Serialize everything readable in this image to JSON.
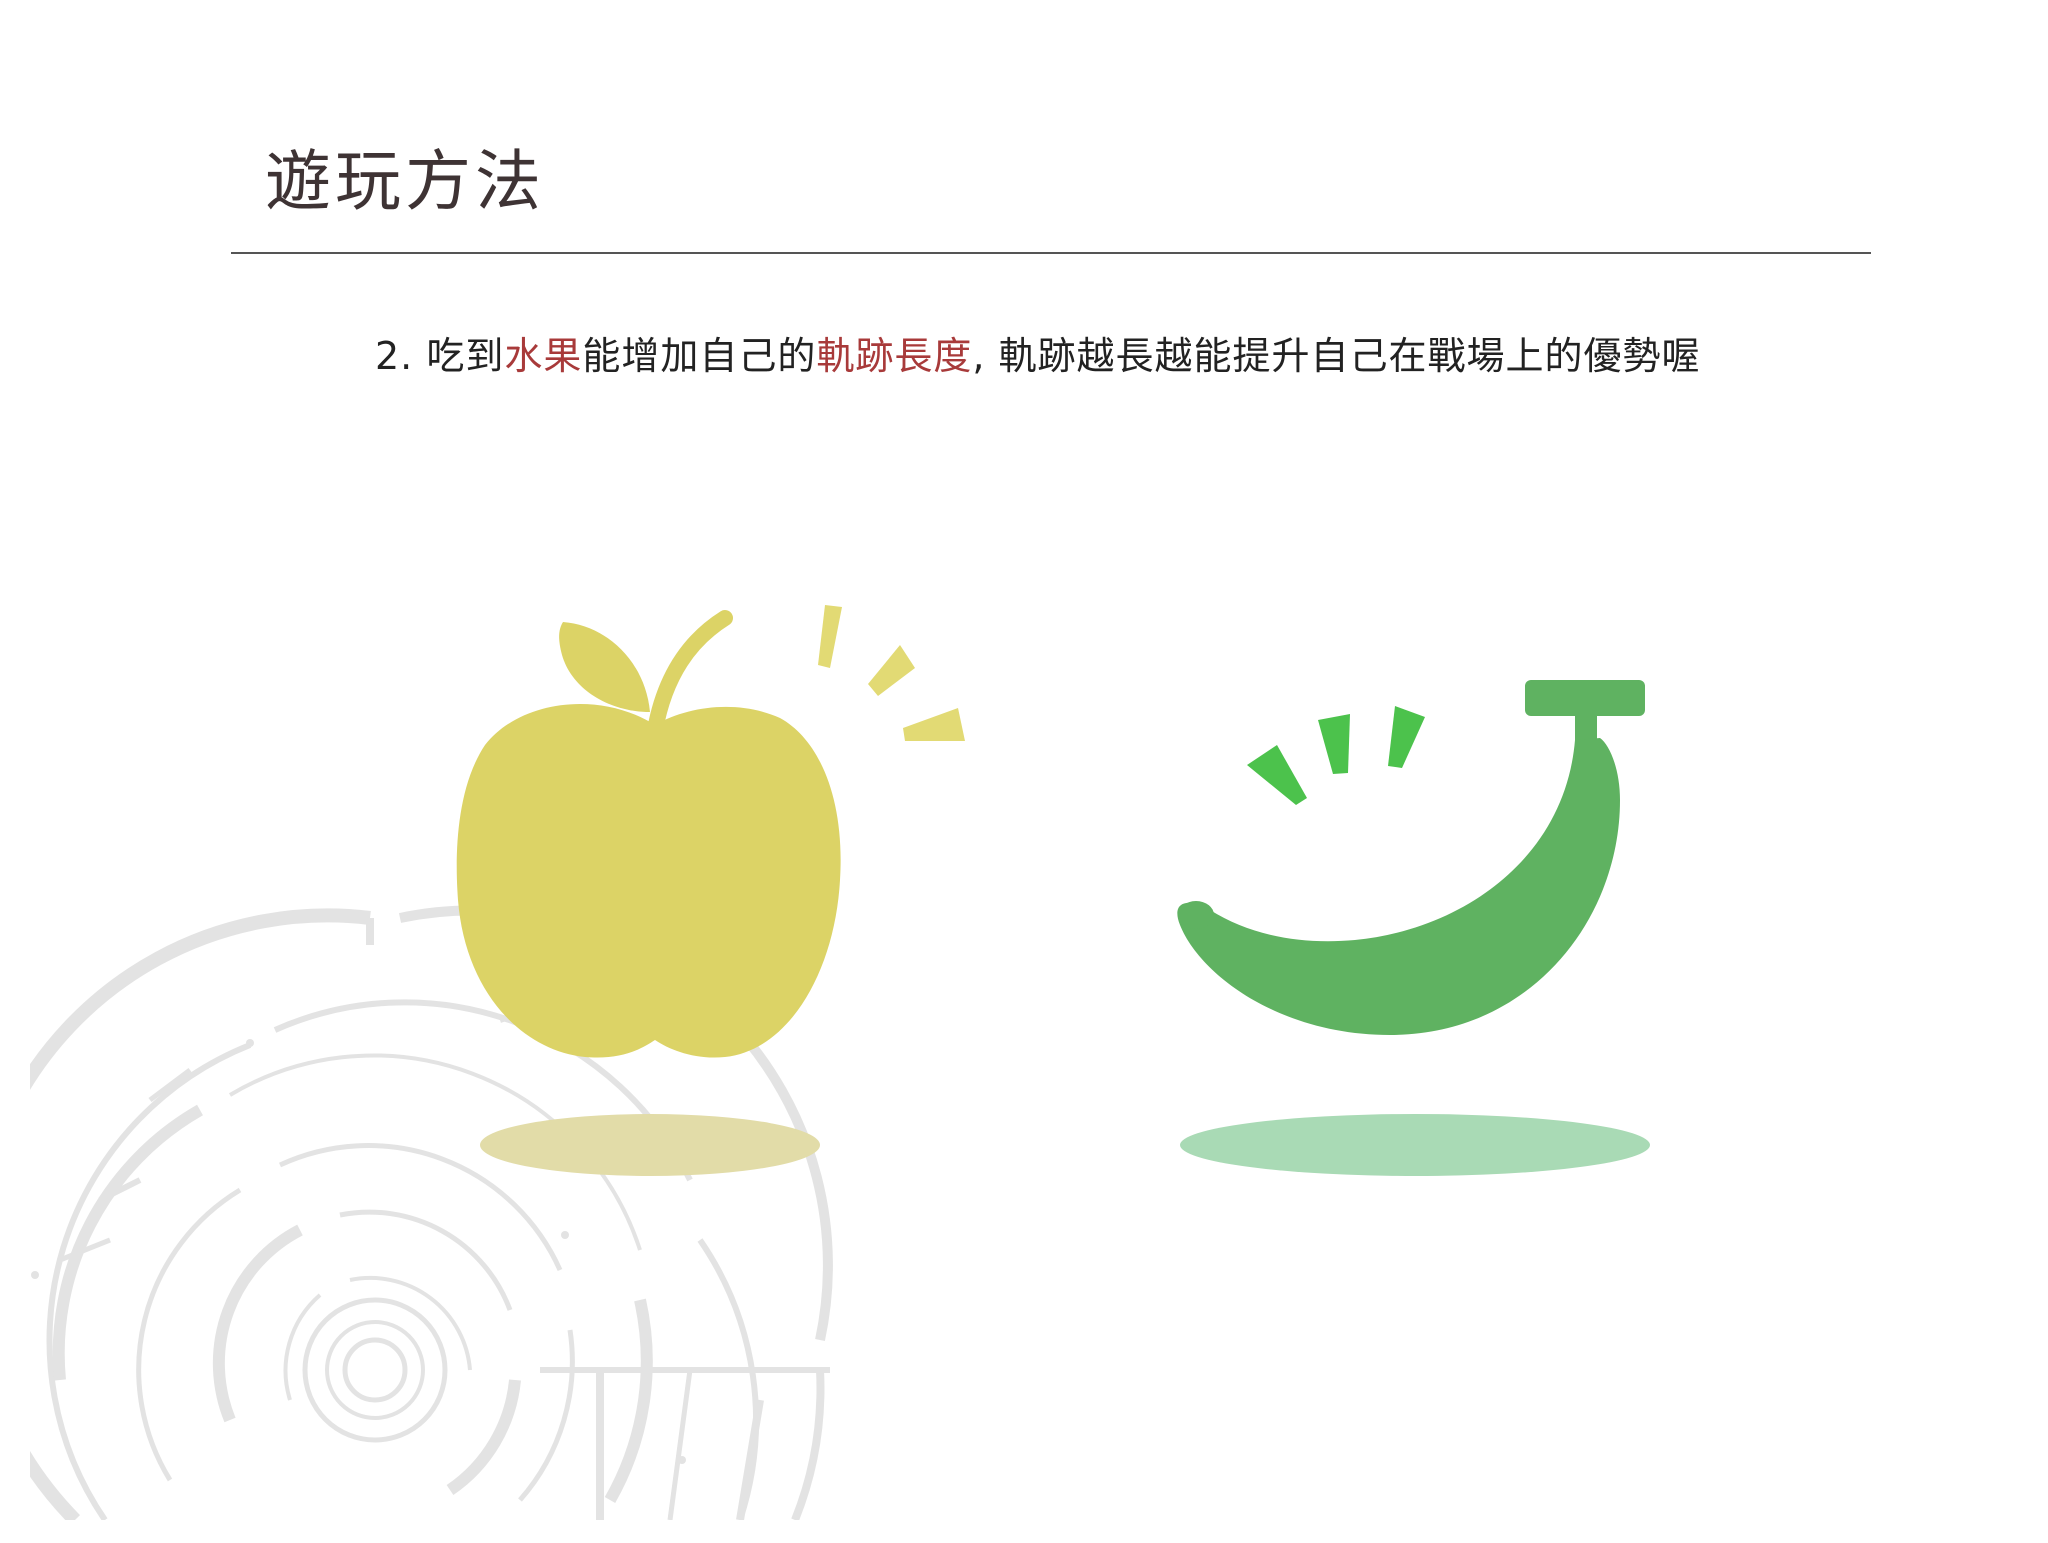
{
  "title": "遊玩方法",
  "instruction": {
    "prefix": "2. 吃到",
    "highlight1": "水果",
    "middle": "能增加自己的",
    "highlight2": "軌跡長度",
    "suffix": ", 軌跡越長越能提升自己在戰場上的優勢喔"
  },
  "colors": {
    "title": "#3e3334",
    "highlight": "#a83a3a",
    "apple": "#dcd366",
    "apple_shadow": "#e2dca8",
    "apple_sparkle": "#e2da74",
    "banana": "#5fb261",
    "banana_shadow": "#a9dab5",
    "banana_sparkle": "#4cc24c",
    "maze": "#e3e3e3"
  },
  "icons": [
    "apple-icon",
    "banana-icon",
    "maze-circle-decoration"
  ]
}
